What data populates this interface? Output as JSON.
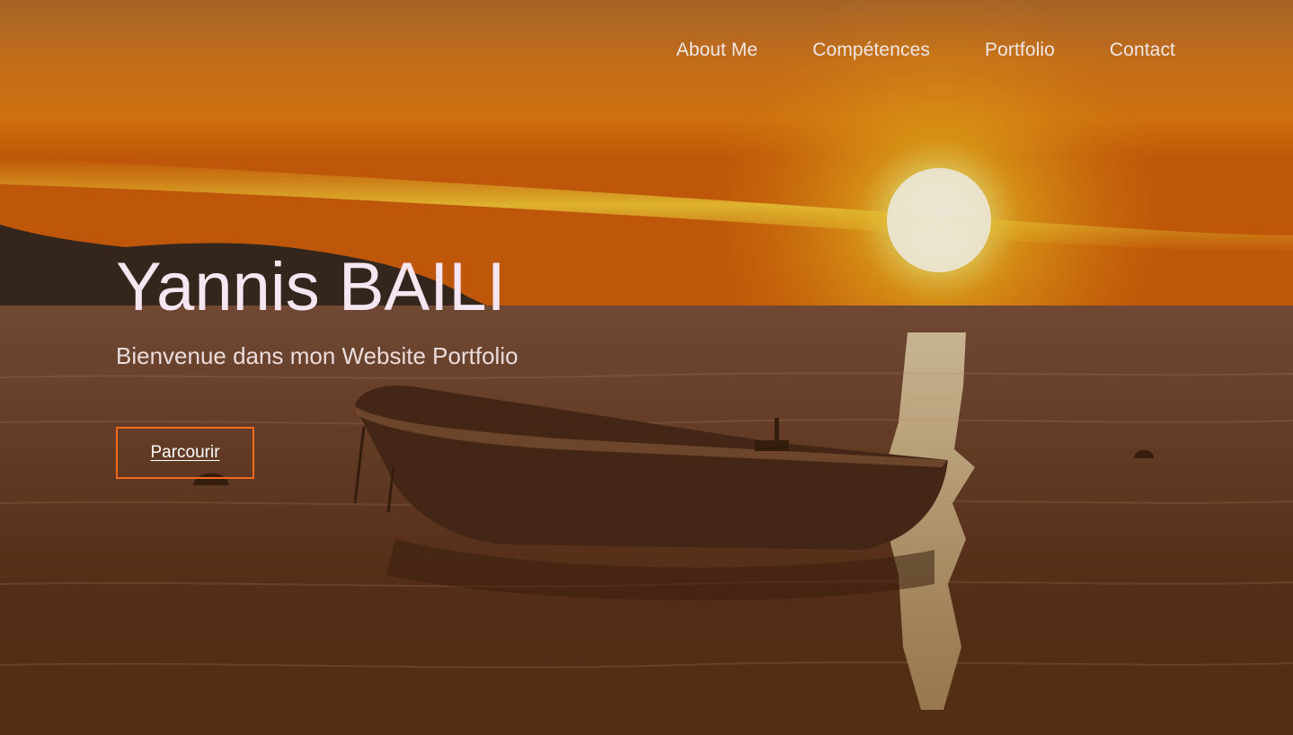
{
  "nav": {
    "items": [
      {
        "label": "About Me"
      },
      {
        "label": "Compétences"
      },
      {
        "label": "Portfolio"
      },
      {
        "label": "Contact"
      }
    ]
  },
  "hero": {
    "title": "Yannis BAILI",
    "subtitle": "Bienvenue dans mon Website Portfolio",
    "cta_label": "Parcourir"
  },
  "colors": {
    "cta_border": "#f26a1b",
    "title_text": "#f5e6f2",
    "nav_text": "#f2e6e6"
  }
}
